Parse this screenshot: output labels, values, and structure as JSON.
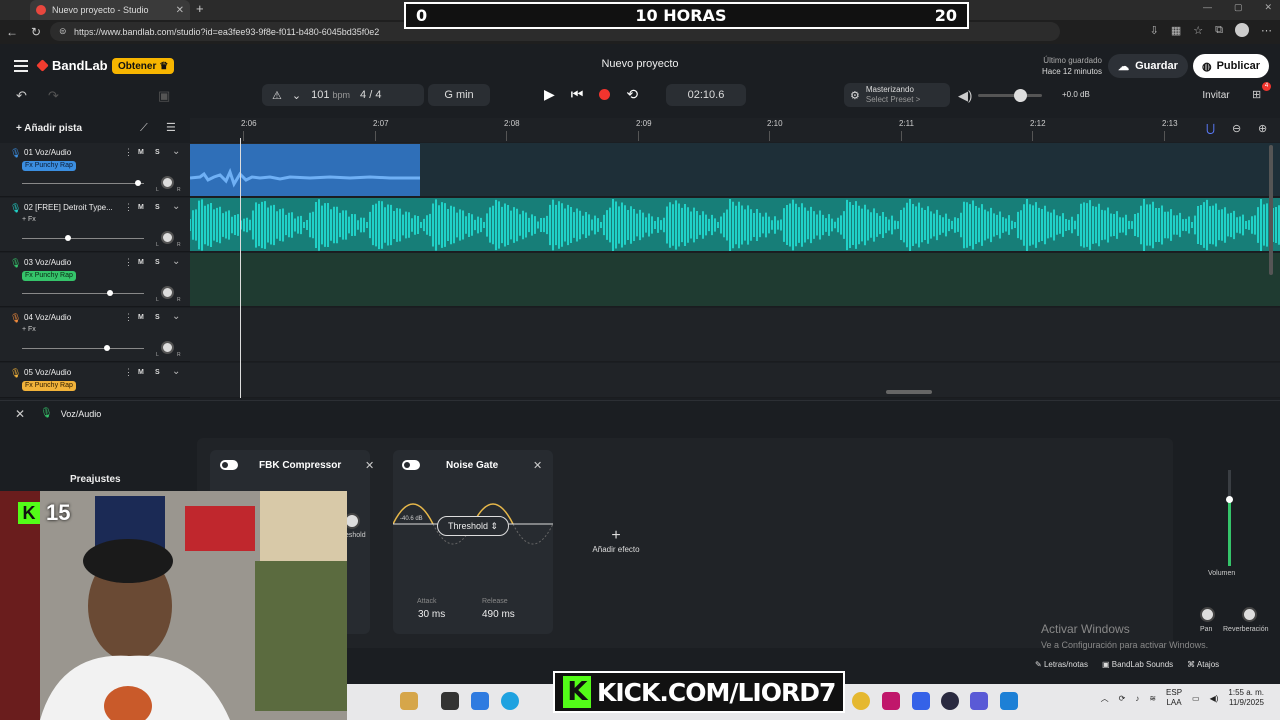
{
  "browser": {
    "tab_title": "Nuevo proyecto - Studio",
    "url": "https://www.bandlab.com/studio?id=ea3fee93-9f8e-f011-b480-6045bd35f0e2"
  },
  "stream_overlay": {
    "timer_left": "0",
    "timer_center": "10 HORAS",
    "timer_right": "20",
    "kick_count": "15",
    "kick_url": "KICK.COM/LIORD7"
  },
  "header": {
    "logo": "BandLab",
    "obtener_label": "Obtener",
    "project_title": "Nuevo proyecto",
    "saved_line1": "Último guardado",
    "saved_line2": "Hace 12 minutos",
    "guardar_label": "Guardar",
    "publicar_label": "Publicar",
    "bpm": "101",
    "bpm_unit": "bpm",
    "time_signature": "4 / 4",
    "key": "G min",
    "time_display": "02:10.6",
    "mastering_title": "Masterizando",
    "mastering_sub": "Select Preset >",
    "volume_db": "+0.0 dB",
    "invitar_label": "Invitar",
    "gift_badge": "4",
    "master_volume_level": 0.6
  },
  "timeline": {
    "add_track_label": "Añadir pista",
    "ticks": [
      "2:06",
      "2:07",
      "2:08",
      "2:09",
      "2:10",
      "2:11",
      "2:12",
      "2:13"
    ]
  },
  "tracks": [
    {
      "name": "01  Voz/Audio",
      "fx": "Fx Punchy Rap",
      "fx_style": "blue",
      "volume": 0.95,
      "color": "#3b8ee0"
    },
    {
      "name": "02  [FREE] Detroit Type...",
      "fx": "+ Fx",
      "fx_style": "plain",
      "volume": 0.38,
      "color": "#20d2c8"
    },
    {
      "name": "03  Voz/Audio",
      "fx": "Fx Punchy Rap",
      "fx_style": "green",
      "volume": 0.72,
      "color": "#35c46a"
    },
    {
      "name": "04  Voz/Audio",
      "fx": "+ Fx",
      "fx_style": "plain",
      "volume": 0.7,
      "color": "#f08a3c"
    },
    {
      "name": "05  Voz/Audio",
      "fx": "Fx Punchy Rap",
      "fx_style": "orange",
      "volume": 0.7,
      "color": "#f2b33a"
    }
  ],
  "track_controls": {
    "mute": "M",
    "solo": "S",
    "pan_l": "L",
    "pan_r": "R"
  },
  "panel": {
    "track_name": "Voz/Audio",
    "preajustes_label": "Preajustes",
    "threshold_partial": "eshold",
    "effects": [
      {
        "title": "FBK Compressor"
      },
      {
        "title": "Noise Gate",
        "threshold_label": "Threshold",
        "db_value": "-40.6 dB",
        "attack_label": "Attack",
        "attack_value": "30 ms",
        "release_label": "Release",
        "release_value": "490 ms"
      }
    ],
    "add_effect_label": "Añadir efecto",
    "volume_label": "Volumen",
    "volume_level": 0.7,
    "pan_label": "Pan",
    "reverb_label": "Reverberación"
  },
  "footer": {
    "lyrics_label": "Letras/notas",
    "sounds_label": "BandLab Sounds",
    "shortcuts_label": "Atajos",
    "activate_title": "Activar Windows",
    "activate_sub": "Ve a Configuración para activar Windows."
  },
  "taskbar": {
    "lang_1": "ESP",
    "lang_2": "LAA",
    "time": "1:55 a. m.",
    "date": "11/9/2025"
  },
  "colors": {
    "accent_red": "#f1342e",
    "obtener_yellow": "#f7b500",
    "track_teal": "#20d2c8",
    "track_blue": "#3b8ee0",
    "kick_green": "#53fc18"
  }
}
